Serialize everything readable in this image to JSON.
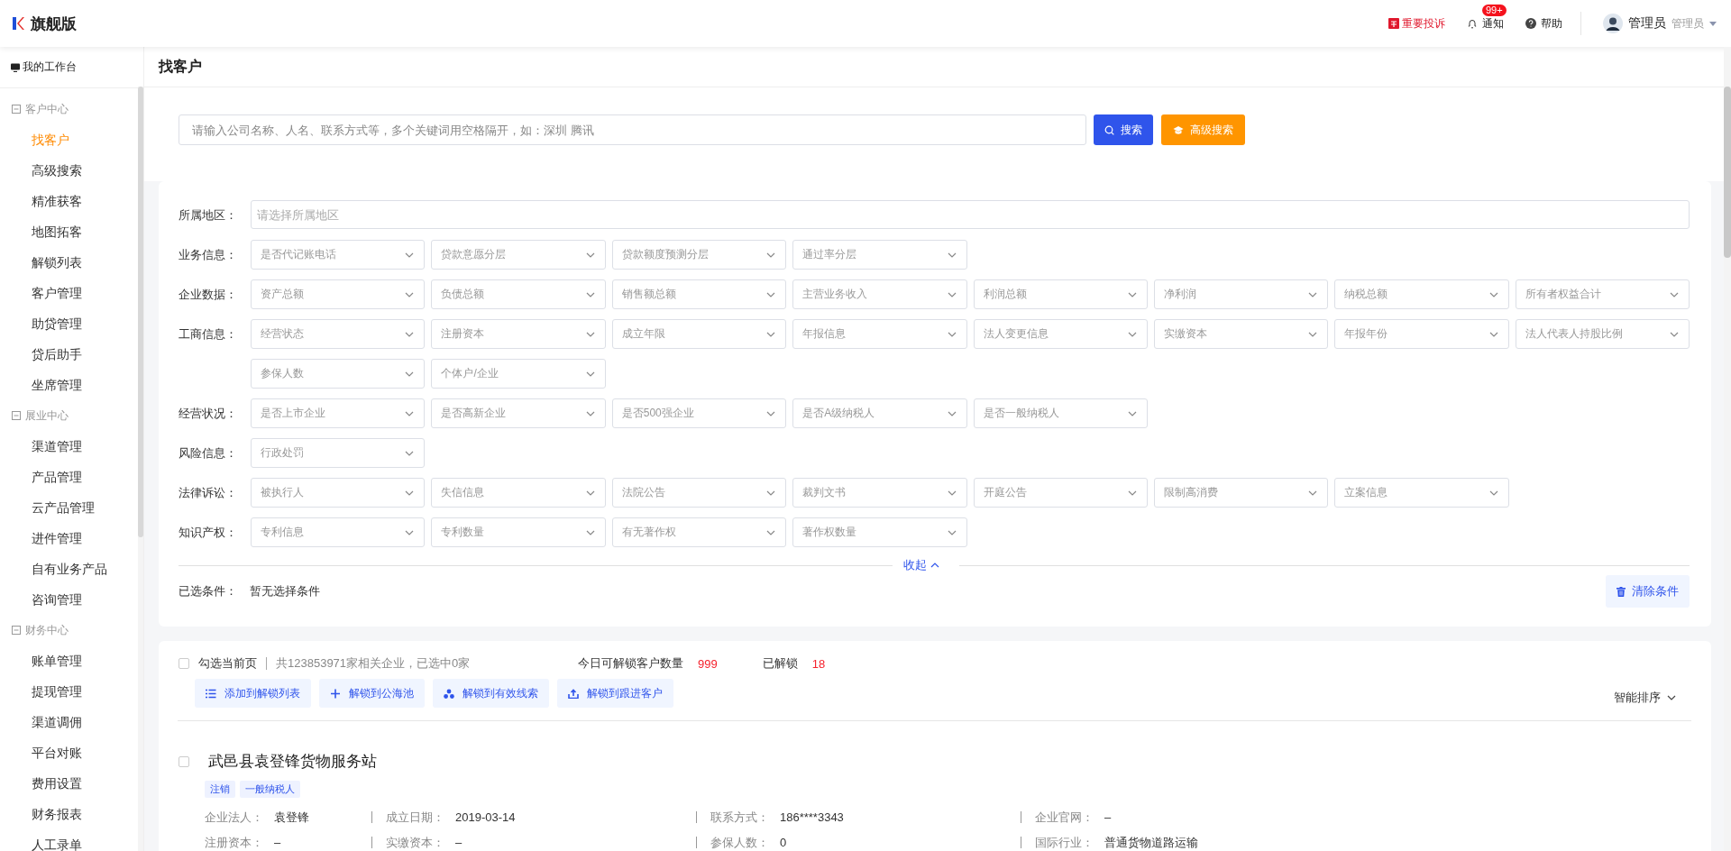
{
  "header": {
    "logo_text": "旗舰版",
    "complaint": "重要投诉",
    "notice": "通知",
    "notice_badge": "99+",
    "help": "帮助",
    "user_name": "管理员",
    "user_role": "管理员"
  },
  "sidebar": {
    "top_item": "我的工作台",
    "groups": [
      {
        "title": "客户中心",
        "expanded": true,
        "items": [
          {
            "label": "找客户",
            "selected": true
          },
          {
            "label": "高级搜索",
            "selected": false
          },
          {
            "label": "精准获客",
            "selected": false
          },
          {
            "label": "地图拓客",
            "selected": false
          },
          {
            "label": "解锁列表",
            "selected": false
          },
          {
            "label": "客户管理",
            "selected": false
          },
          {
            "label": "助贷管理",
            "selected": false
          },
          {
            "label": "贷后助手",
            "selected": false
          },
          {
            "label": "坐席管理",
            "selected": false
          }
        ]
      },
      {
        "title": "展业中心",
        "expanded": true,
        "items": [
          {
            "label": "渠道管理",
            "selected": false
          },
          {
            "label": "产品管理",
            "selected": false
          },
          {
            "label": "云产品管理",
            "selected": false
          },
          {
            "label": "进件管理",
            "selected": false
          },
          {
            "label": "自有业务产品",
            "selected": false
          },
          {
            "label": "咨询管理",
            "selected": false
          }
        ]
      },
      {
        "title": "财务中心",
        "expanded": true,
        "items": [
          {
            "label": "账单管理",
            "selected": false
          },
          {
            "label": "提现管理",
            "selected": false
          },
          {
            "label": "渠道调佣",
            "selected": false
          },
          {
            "label": "平台对账",
            "selected": false
          },
          {
            "label": "费用设置",
            "selected": false
          },
          {
            "label": "财务报表",
            "selected": false
          },
          {
            "label": "人工录单",
            "selected": false
          }
        ]
      }
    ]
  },
  "page_title": "找客户",
  "search": {
    "placeholder": "请输入公司名称、人名、联系方式等，多个关键词用空格隔开，如：深圳 腾讯",
    "search_button": "搜索",
    "advanced_button": "高级搜索"
  },
  "filters": {
    "region": {
      "label": "所属地区：",
      "placeholder": "请选择所属地区"
    },
    "rows": [
      {
        "label": "业务信息：",
        "selects": [
          "是否代记账电话",
          "贷款意愿分层",
          "贷款额度预测分层",
          "通过率分层"
        ]
      },
      {
        "label": "企业数据：",
        "selects": [
          "资产总额",
          "负债总额",
          "销售额总额",
          "主营业务收入",
          "利润总额",
          "净利润",
          "纳税总额",
          "所有者权益合计"
        ]
      },
      {
        "label": "工商信息：",
        "selects": [
          "经营状态",
          "注册资本",
          "成立年限",
          "年报信息",
          "法人变更信息",
          "实缴资本",
          "年报年份",
          "法人代表人持股比例"
        ]
      },
      {
        "label": "",
        "selects": [
          "参保人数",
          "个体户/企业"
        ]
      },
      {
        "label": "经营状况：",
        "selects": [
          "是否上市企业",
          "是否高新企业",
          "是否500强企业",
          "是否A级纳税人",
          "是否一般纳税人"
        ]
      },
      {
        "label": "风险信息：",
        "selects": [
          "行政处罚"
        ]
      },
      {
        "label": "法律诉讼：",
        "selects": [
          "被执行人",
          "失信信息",
          "法院公告",
          "裁判文书",
          "开庭公告",
          "限制高消费",
          "立案信息"
        ]
      },
      {
        "label": "知识产权：",
        "selects": [
          "专利信息",
          "专利数量",
          "有无著作权",
          "著作权数量"
        ]
      }
    ],
    "collapse": "收起",
    "selected_label": "已选条件：",
    "selected_value": "暂无选择条件",
    "clear_button": "清除条件"
  },
  "results": {
    "select_page": {
      "label": "勾选当前页",
      "checked": false
    },
    "summary": "共123853971家相关企业，已选中0家",
    "quota_label": "今日可解锁客户数量",
    "quota_value": "999",
    "unlocked_label": "已解锁",
    "unlocked_value": "18",
    "actions": [
      {
        "kind": "list",
        "label": "添加到解锁列表"
      },
      {
        "kind": "plus",
        "label": "解锁到公海池"
      },
      {
        "kind": "clue",
        "label": "解锁到有效线索"
      },
      {
        "kind": "upload",
        "label": "解锁到跟进客户"
      }
    ],
    "sort": "智能排序",
    "companies": [
      {
        "name": "武邑县袁登锋货物服务站",
        "checked": false,
        "tags": [
          "注销",
          "一般纳税人"
        ],
        "fields": [
          [
            {
              "label": "企业法人：",
              "value": "袁登锋"
            },
            {
              "label": "成立日期：",
              "value": "2019-03-14"
            },
            {
              "label": "联系方式：",
              "value": "186****3343"
            },
            {
              "label": "企业官网：",
              "value": "–"
            }
          ],
          [
            {
              "label": "注册资本：",
              "value": "–"
            },
            {
              "label": "实缴资本：",
              "value": "–"
            },
            {
              "label": "参保人数：",
              "value": "0"
            },
            {
              "label": "国际行业：",
              "value": "普通货物道路运输"
            }
          ]
        ]
      }
    ]
  }
}
